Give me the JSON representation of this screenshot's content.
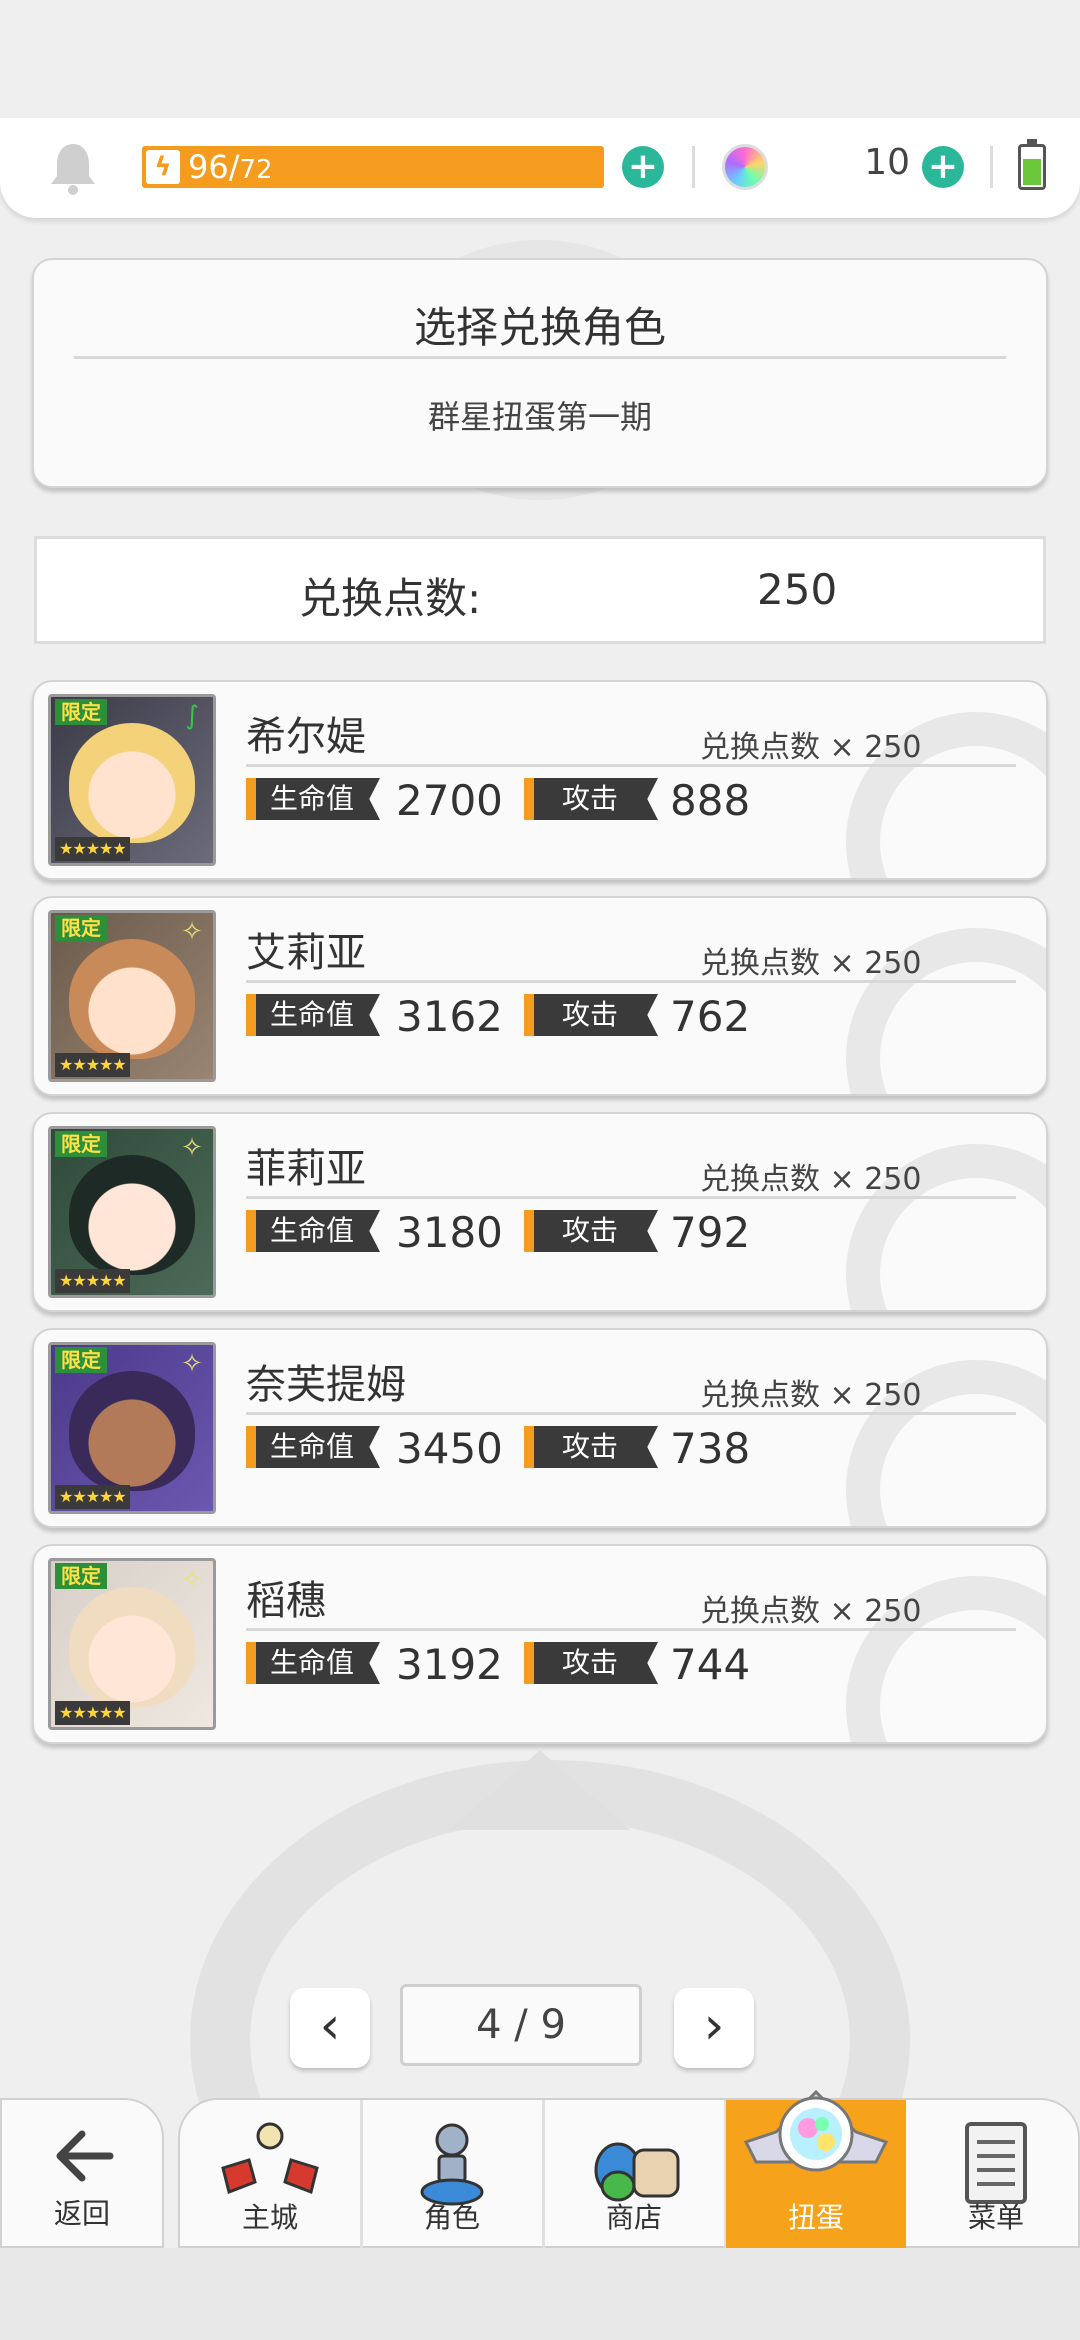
{
  "status": {
    "energy_current": "96/",
    "energy_max": "72",
    "gem_count": "10",
    "icons": [
      "bell-icon",
      "lightning-icon",
      "plus-icon",
      "rainbow-gem-icon",
      "battery-icon"
    ]
  },
  "header": {
    "title": "选择兑换角色",
    "subtitle": "群星扭蛋第一期"
  },
  "points": {
    "label": "兑换点数:",
    "value": "250"
  },
  "labels": {
    "limited": "限定",
    "hp": "生命值",
    "atk": "攻击",
    "stars": "★★★★★"
  },
  "characters": [
    {
      "name": "希尔媞",
      "cost": "兑换点数 × 250",
      "hp": "2700",
      "atk": "888",
      "element": "wind-icon"
    },
    {
      "name": "艾莉亚",
      "cost": "兑换点数 × 250",
      "hp": "3162",
      "atk": "762",
      "element": "light-icon"
    },
    {
      "name": "菲莉亚",
      "cost": "兑换点数 × 250",
      "hp": "3180",
      "atk": "792",
      "element": "light-icon"
    },
    {
      "name": "奈芙提姆",
      "cost": "兑换点数 × 250",
      "hp": "3450",
      "atk": "738",
      "element": "light-icon"
    },
    {
      "name": "稻穗",
      "cost": "兑换点数 × 250",
      "hp": "3192",
      "atk": "744",
      "element": "light-icon"
    }
  ],
  "pagination": {
    "current": "4 / 9"
  },
  "nav": {
    "back": "返回",
    "city": "主城",
    "character": "角色",
    "shop": "商店",
    "gacha": "扭蛋",
    "menu": "菜单"
  },
  "colors": {
    "accent_orange": "#f59b1d",
    "plus_teal": "#2bb79a",
    "limited_green": "#2e8f3a"
  }
}
